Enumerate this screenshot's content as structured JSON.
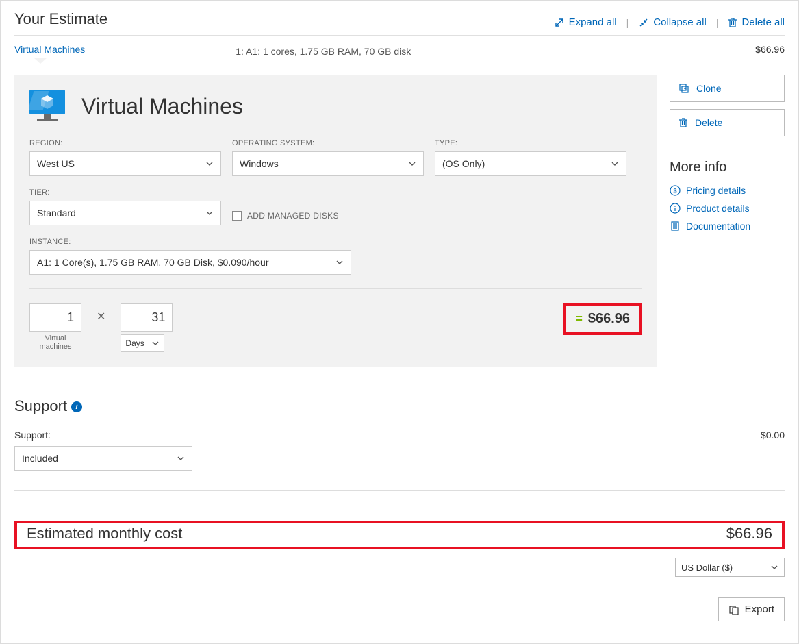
{
  "header": {
    "title": "Your Estimate",
    "expand_all": "Expand all",
    "collapse_all": "Collapse all",
    "delete_all": "Delete all"
  },
  "tab": {
    "label": "Virtual Machines",
    "summary": "1: A1: 1 cores, 1.75 GB RAM, 70 GB disk",
    "cost": "$66.96"
  },
  "panel": {
    "title": "Virtual Machines",
    "region_label": "REGION:",
    "region_value": "West US",
    "os_label": "OPERATING SYSTEM:",
    "os_value": "Windows",
    "type_label": "TYPE:",
    "type_value": "(OS Only)",
    "tier_label": "TIER:",
    "tier_value": "Standard",
    "managed_disks": "ADD MANAGED DISKS",
    "instance_label": "INSTANCE:",
    "instance_value": "A1: 1 Core(s), 1.75 GB RAM, 70 GB Disk, $0.090/hour",
    "vm_count": "1",
    "vm_count_label": "Virtual\nmachines",
    "duration": "31",
    "duration_unit": "Days",
    "subtotal": "$66.96"
  },
  "sidebar": {
    "clone": "Clone",
    "delete": "Delete",
    "more_info": "More info",
    "pricing": "Pricing details",
    "product": "Product details",
    "docs": "Documentation"
  },
  "support": {
    "heading": "Support",
    "label": "Support:",
    "cost": "$0.00",
    "value": "Included"
  },
  "total": {
    "label": "Estimated monthly cost",
    "value": "$66.96"
  },
  "footer": {
    "currency": "US Dollar ($)",
    "export": "Export"
  }
}
